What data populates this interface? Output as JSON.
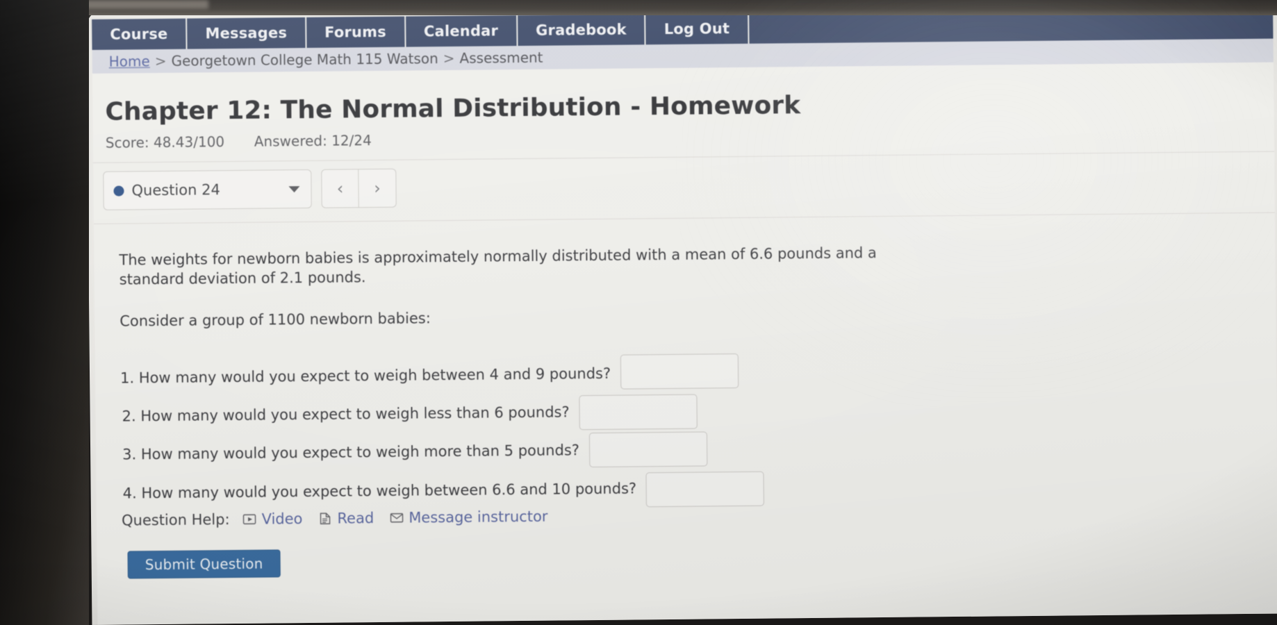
{
  "nav": {
    "items": [
      {
        "label": "Course",
        "name": "nav-course"
      },
      {
        "label": "Messages",
        "name": "nav-messages"
      },
      {
        "label": "Forums",
        "name": "nav-forums"
      },
      {
        "label": "Calendar",
        "name": "nav-calendar"
      },
      {
        "label": "Gradebook",
        "name": "nav-gradebook"
      },
      {
        "label": "Log Out",
        "name": "nav-logout"
      }
    ],
    "background_color": "#36466a"
  },
  "breadcrumb": {
    "home": "Home",
    "separator_1": ">",
    "course": "Georgetown College Math 115 Watson",
    "separator_2": ">",
    "current": "Assessment"
  },
  "header": {
    "title": "Chapter 12: The Normal Distribution - Homework",
    "score_label": "Score: 48.43/100",
    "answered_label": "Answered: 12/24"
  },
  "question_selector": {
    "current": "Question 24",
    "status_dot_color": "#2f5796",
    "caret_icon": "chevron-down-icon",
    "prev_label": "‹",
    "next_label": "›"
  },
  "question": {
    "intro": "The weights for newborn babies is approximately normally distributed with a mean of 6.6 pounds and a standard deviation of 2.1 pounds.",
    "group_line": "Consider a group of 1100 newborn babies:",
    "parts": [
      {
        "text": "1. How many would you expect to weigh between 4 and 9 pounds?",
        "answer": ""
      },
      {
        "text": "2. How many would you expect to weigh less than 6 pounds?",
        "answer": ""
      },
      {
        "text": "3. How many would you expect to weigh more than 5 pounds?",
        "answer": ""
      },
      {
        "text": "4. How many would you expect to weigh between 6.6 and 10 pounds?",
        "answer": ""
      }
    ]
  },
  "help": {
    "label": "Question Help:",
    "items": [
      {
        "label": "Video",
        "icon": "play-video-icon"
      },
      {
        "label": "Read",
        "icon": "document-read-icon"
      },
      {
        "label": "Message instructor",
        "icon": "envelope-icon"
      }
    ],
    "link_color": "#5464a8"
  },
  "submit": {
    "label": "Submit Question",
    "color": "#2c6aa8"
  }
}
